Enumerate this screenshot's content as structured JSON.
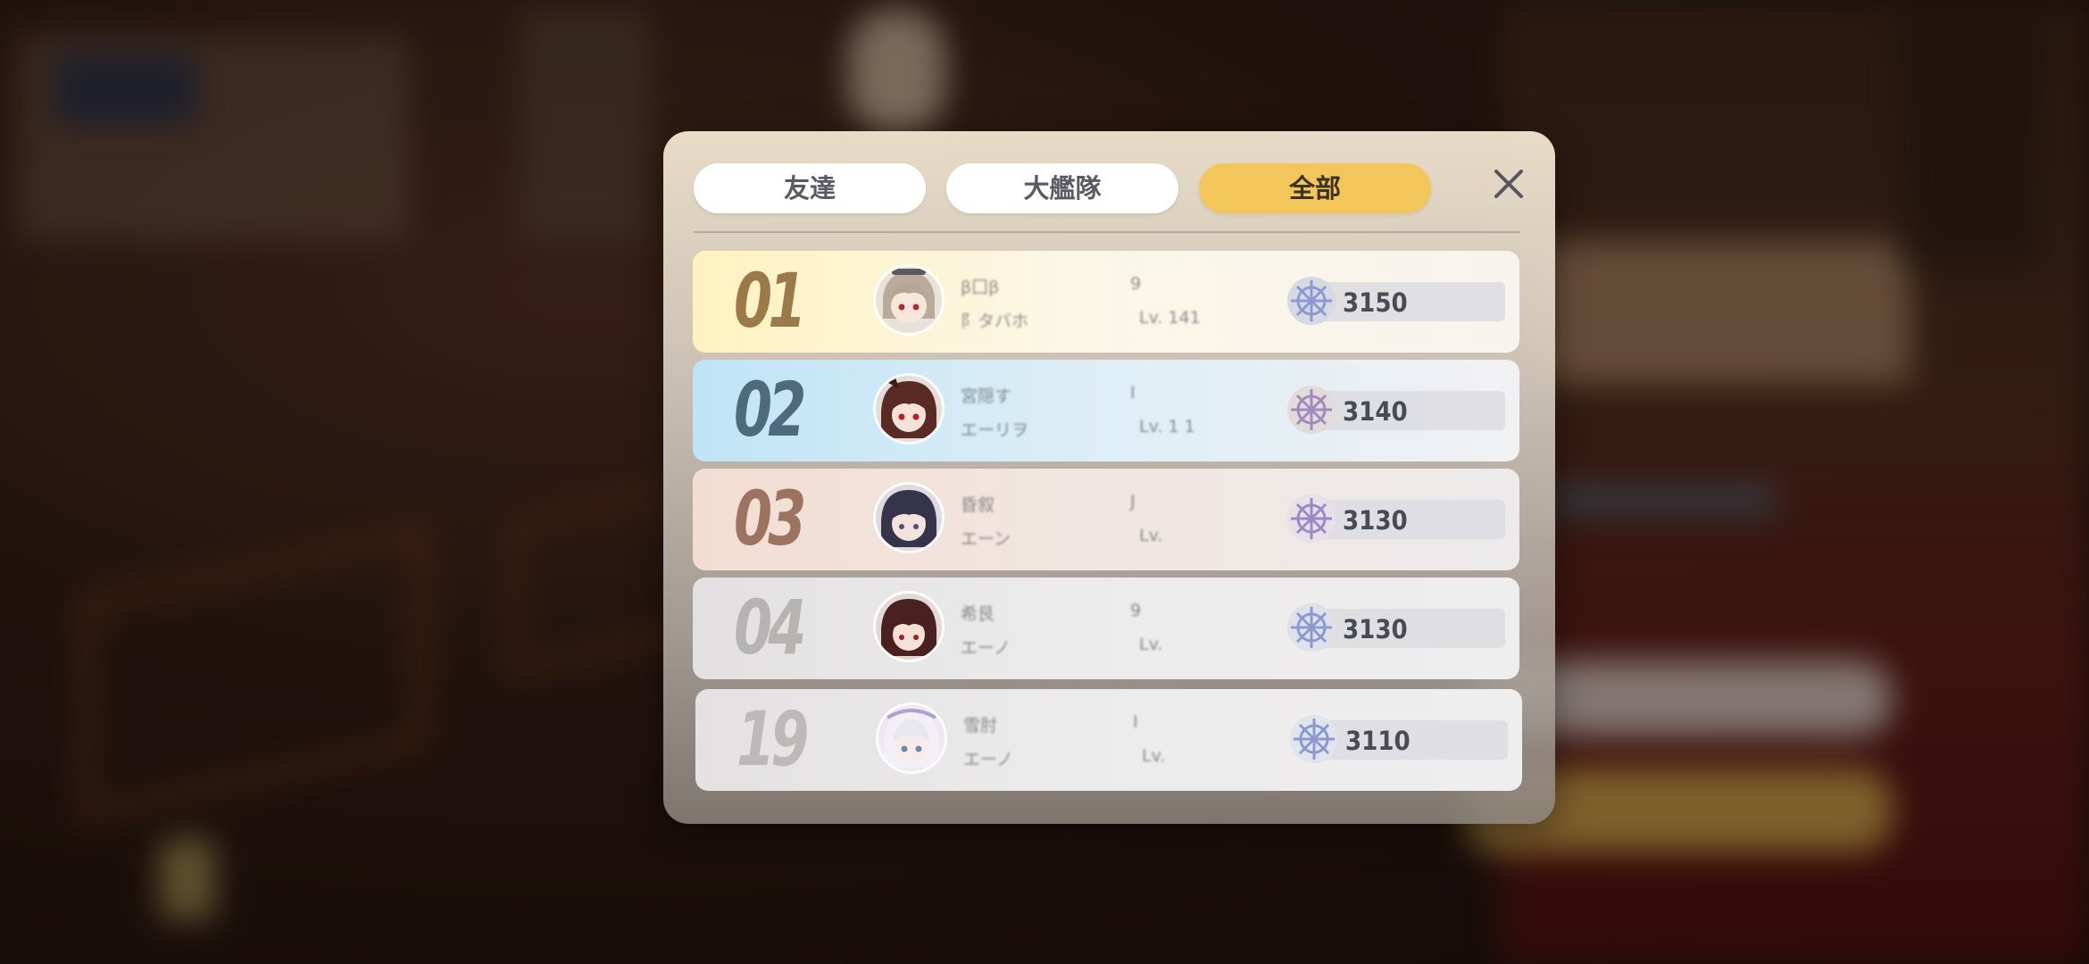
{
  "tabs": [
    {
      "label": "友達",
      "active": false
    },
    {
      "label": "大艦隊",
      "active": false
    },
    {
      "label": "全部",
      "active": true
    }
  ],
  "colors": {
    "active_tab": "#f2c65a",
    "rank1": "#fff2c0",
    "rank2": "#bfe4f6",
    "rank3": "#f3ddd2",
    "rank_other": "#e6e4e4"
  },
  "close_icon": "close-icon",
  "rows": [
    {
      "rank": "01",
      "name": "β囗β",
      "fleet": "阝タバホ",
      "rank_icon": "shield-icon",
      "rank_text": "9",
      "level": "Lv. 141",
      "score_icon": "ship-wheel-icon",
      "score": "3150"
    },
    {
      "rank": "02",
      "name": "宮隠す",
      "fleet": "エーリヲ",
      "rank_icon": "shield-icon",
      "rank_text": "I",
      "level": "Lv. 1 1",
      "score_icon": "ship-wheel-icon",
      "score": "3140"
    },
    {
      "rank": "03",
      "name": "昏叙",
      "fleet": "エーン",
      "rank_icon": "shield-icon",
      "rank_text": "J",
      "level": "Lv.",
      "score_icon": "ship-wheel-icon",
      "score": "3130"
    },
    {
      "rank": "04",
      "name": "希艮",
      "fleet": "エーノ",
      "rank_icon": "shield-icon",
      "rank_text": "9",
      "level": "Lv.",
      "score_icon": "ship-wheel-icon",
      "score": "3130"
    },
    {
      "rank": "19",
      "name": "雪肘",
      "fleet": "エーノ",
      "rank_icon": "shield-icon",
      "rank_text": "I",
      "level": "Lv.",
      "score_icon": "ship-wheel-icon",
      "score": "3110"
    }
  ]
}
